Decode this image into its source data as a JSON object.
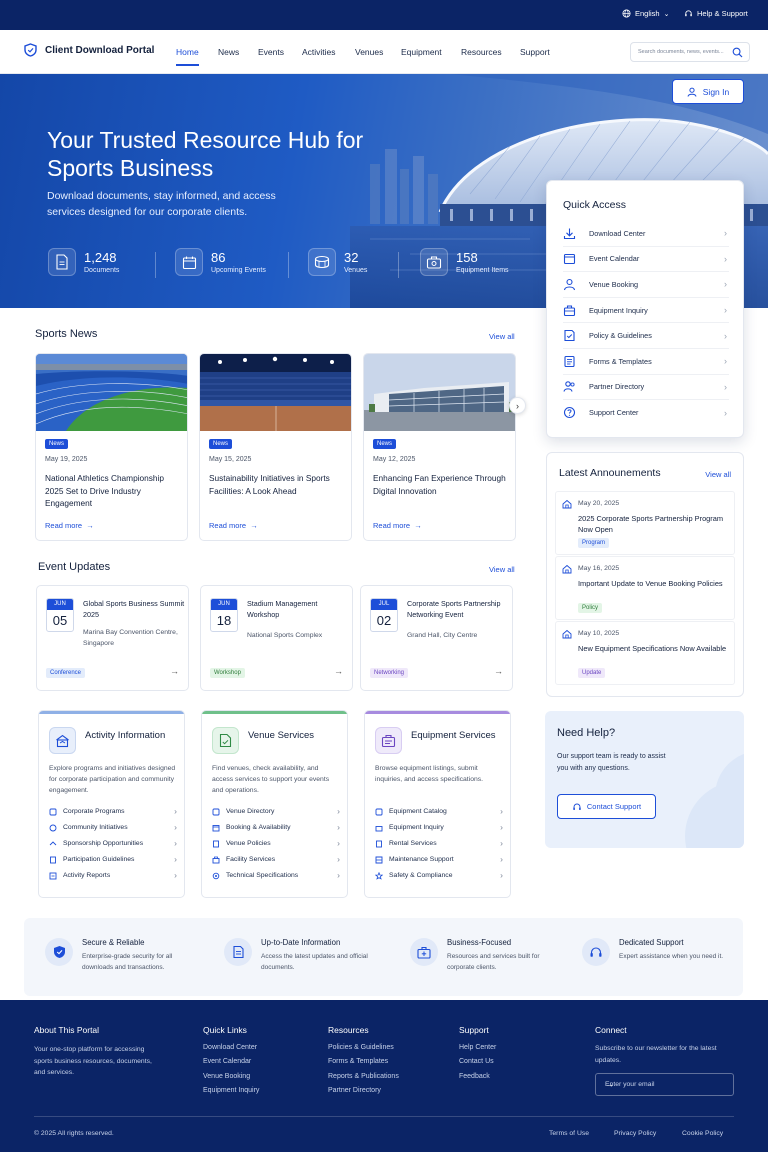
{
  "topbar": {
    "language": "English",
    "help": "Help & Support"
  },
  "header": {
    "brand": "Client Download Portal",
    "nav": [
      "Home",
      "News",
      "Events",
      "Activities",
      "Venues",
      "Equipment",
      "Resources",
      "Support"
    ],
    "search_placeholder": "Search documents, news, events...",
    "sign_in": "Sign In"
  },
  "hero": {
    "title": "Your Trusted Resource Hub for Sports Business",
    "subtitle": "Download documents, stay informed, and access services designed for our corporate clients.",
    "stats": [
      {
        "value": "1,248",
        "label": "Documents",
        "icon": "document-icon"
      },
      {
        "value": "86",
        "label": "Upcoming Events",
        "icon": "calendar-icon"
      },
      {
        "value": "32",
        "label": "Venues",
        "icon": "stadium-icon"
      },
      {
        "value": "158",
        "label": "Equipment Items",
        "icon": "equipment-icon"
      }
    ]
  },
  "quick_access": {
    "title": "Quick Access",
    "items": [
      "Download Center",
      "Event Calendar",
      "Venue Booking",
      "Equipment Inquiry",
      "Policy & Guidelines",
      "Forms & Templates",
      "Partner Directory",
      "Support Center"
    ]
  },
  "news": {
    "title": "Sports News",
    "view_all": "View all",
    "items": [
      {
        "tag": "News",
        "date": "May 19, 2025",
        "title": "National Athletics Championship 2025 Set to Drive Industry Engagement",
        "read_more": "Read more"
      },
      {
        "tag": "News",
        "date": "May 15, 2025",
        "title": "Sustainability Initiatives in Sports Facilities: A Look Ahead",
        "read_more": "Read more"
      },
      {
        "tag": "News",
        "date": "May 12, 2025",
        "title": "Enhancing Fan Experience Through Digital Innovation",
        "read_more": "Read more"
      }
    ]
  },
  "events": {
    "title": "Event Updates",
    "view_all": "View all",
    "items": [
      {
        "month": "JUN",
        "day": "05",
        "title": "Global Sports Business Summit 2025",
        "location": "Marina Bay Convention Centre, Singapore",
        "tag": "Conference"
      },
      {
        "month": "JUN",
        "day": "18",
        "title": "Stadium Management Workshop",
        "location": "National Sports Complex",
        "tag": "Workshop"
      },
      {
        "month": "JUL",
        "day": "02",
        "title": "Corporate Sports Partnership Networking Event",
        "location": "Grand Hall, City Centre",
        "tag": "Networking"
      }
    ]
  },
  "announcements": {
    "title": "Latest Announements",
    "view_all": "View all",
    "items": [
      {
        "date": "May 20, 2025",
        "title": "2025 Corporate Sports Partnership Program Now Open",
        "tag": "Program"
      },
      {
        "date": "May 16, 2025",
        "title": "Important Update to Venue Booking Policies",
        "tag": "Policy"
      },
      {
        "date": "May 10, 2025",
        "title": "New Equipment Specifications Now Available",
        "tag": "Update"
      }
    ]
  },
  "services": [
    {
      "title": "Activity Information",
      "desc": "Explore programs and initiatives designed for corporate participation and community engagement.",
      "items": [
        "Corporate Programs",
        "Community Initiatives",
        "Sponsorship Opportunities",
        "Participation Guidelines",
        "Activity Reports"
      ]
    },
    {
      "title": "Venue Services",
      "desc": "Find venues, check availability, and access services to support your events and operations.",
      "items": [
        "Venue Directory",
        "Booking & Availability",
        "Venue Policies",
        "Facility Services",
        "Technical Specifications"
      ]
    },
    {
      "title": "Equipment Services",
      "desc": "Browse equipment listings, submit inquiries, and access specifications.",
      "items": [
        "Equipment Catalog",
        "Equipment Inquiry",
        "Rental Services",
        "Maintenance Support",
        "Safety & Compliance"
      ]
    }
  ],
  "help": {
    "title": "Need Help?",
    "text": "Our support team is ready to assist you with any questions.",
    "button": "Contact Support"
  },
  "features": [
    {
      "title": "Secure & Reliable",
      "desc": "Enterprise-grade security for all downloads and transactions."
    },
    {
      "title": "Up-to-Date Information",
      "desc": "Access the latest updates and official documents."
    },
    {
      "title": "Business-Focused",
      "desc": "Resources and services built for corporate clients."
    },
    {
      "title": "Dedicated Support",
      "desc": "Expert assistance when you need it."
    }
  ],
  "footer": {
    "about_title": "About This Portal",
    "about_text": "Your one-stop platform for accessing sports business resources, documents, and services.",
    "quick_links_title": "Quick Links",
    "quick_links": [
      "Download Center",
      "Event Calendar",
      "Venue Booking",
      "Equipment Inquiry"
    ],
    "resources_title": "Resources",
    "resources": [
      "Policies & Guidelines",
      "Forms & Templates",
      "Reports & Publications",
      "Partner Directory"
    ],
    "support_title": "Support",
    "support": [
      "Help Center",
      "Contact Us",
      "Feedback"
    ],
    "connect_title": "Connect",
    "connect_text": "Subscribe to our newsletter for the latest updates.",
    "email_placeholder": "Enter your email",
    "copyright": "© 2025 All rights reserved.",
    "legal": [
      "Terms of Use",
      "Privacy Policy",
      "Cookie Policy"
    ]
  },
  "colors": {
    "primary": "#1d4ed8",
    "navy": "#0b2466",
    "hero_start": "#1447a8"
  }
}
